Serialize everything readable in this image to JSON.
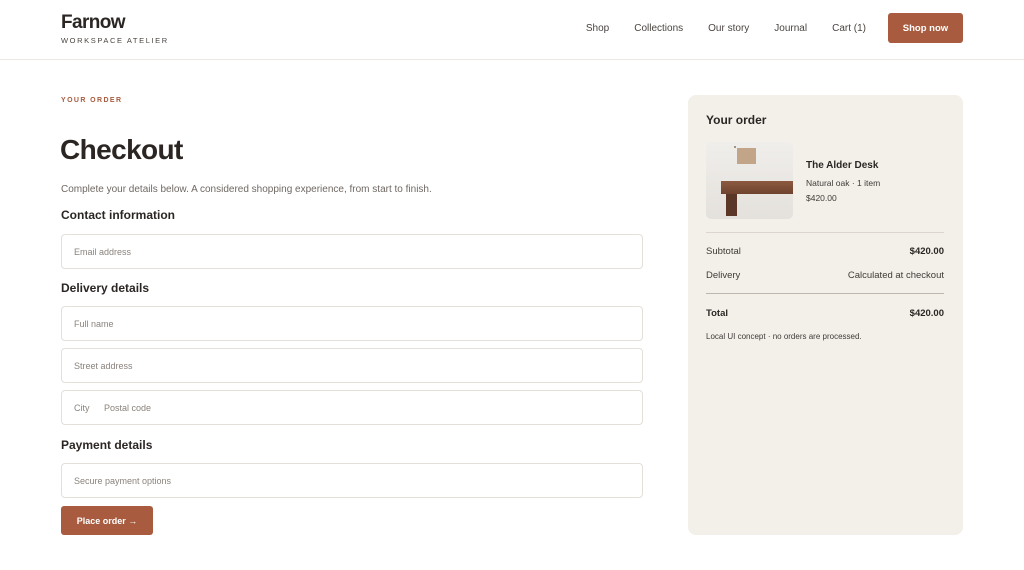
{
  "brand": {
    "name": "Farnow",
    "tagline": "WORKSPACE ATELIER"
  },
  "nav": {
    "items": [
      {
        "label": "Shop"
      },
      {
        "label": "Collections"
      },
      {
        "label": "Our story"
      },
      {
        "label": "Journal"
      },
      {
        "label": "Cart (1)"
      }
    ],
    "cta_label": "Shop now"
  },
  "checkout": {
    "eyebrow": "YOUR ORDER",
    "title": "Checkout",
    "subtitle": "Complete your details below. A considered shopping experience, from start to finish.",
    "contact": {
      "title": "Contact information",
      "email_placeholder": "Email address"
    },
    "delivery": {
      "title": "Delivery details",
      "fullname_placeholder": "Full name",
      "street_placeholder": "Street address",
      "city_placeholder": "City",
      "postal_placeholder": "Postal code"
    },
    "payment": {
      "title": "Payment details",
      "options_placeholder": "Secure payment options"
    },
    "place_order_label": "Place order →"
  },
  "summary": {
    "title": "Your order",
    "product": {
      "name": "The Alder Desk",
      "meta": "Natural oak · 1 item",
      "price": "$420.00",
      "image_icon": "desk-product-image"
    },
    "subtotal_label": "Subtotal",
    "subtotal_value": "$420.00",
    "delivery_label": "Delivery",
    "delivery_value": "Calculated at checkout",
    "total_label": "Total",
    "total_value": "$420.00",
    "note": "Local UI concept · no orders are processed."
  },
  "colors": {
    "accent": "#a85b3e",
    "summary_bg": "#f3f0ea",
    "text": "#2b2623"
  }
}
